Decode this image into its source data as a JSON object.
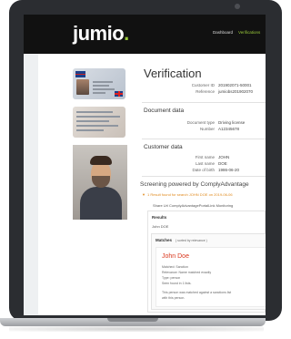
{
  "app": {
    "logo": "jumio",
    "logo_dot": "."
  },
  "nav": {
    "dashboard": "Dashboard",
    "verifications": "Verifications"
  },
  "verification": {
    "title": "Verification",
    "fields": [
      {
        "label": "Customer ID",
        "value": "201902071-50001"
      },
      {
        "label": "Reference",
        "value": "jumiobs201902070"
      }
    ]
  },
  "document_data": {
    "title": "Document data",
    "fields": [
      {
        "label": "Document type",
        "value": "Driving license"
      },
      {
        "label": "Number",
        "value": "A12345678"
      }
    ]
  },
  "customer_data": {
    "title": "Customer data",
    "fields": [
      {
        "label": "First name",
        "value": "JOHN"
      },
      {
        "label": "Last name",
        "value": "DOE"
      },
      {
        "label": "Date of birth",
        "value": "1986-06-20"
      }
    ]
  },
  "screening": {
    "title": "Screening powered by ComplyAdvantage",
    "result_line": "1 Result found for search JOHN DOE on 2019-06-06",
    "share_line": "Share Url   ComplyAdvantagePortalLink   Monitoring",
    "results_label": "Results",
    "results_name": "John DOE",
    "matches_label": "Matches",
    "matches_sort": "( sorted by relevance )",
    "match": {
      "name": "John Doe",
      "lines": [
        "Matched: Sanction",
        "Relevance: Name matched exactly",
        "Type: person",
        "Seen found in 1 lists.",
        "This person was matched against a sanctions list",
        "with this person."
      ]
    }
  },
  "colors": {
    "brand_green": "#9ccc3b",
    "header_bg": "#111111",
    "alert_orange": "#e08a1e",
    "match_red": "#d9371d"
  }
}
